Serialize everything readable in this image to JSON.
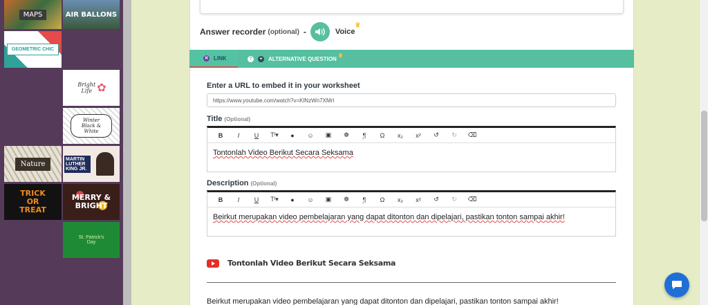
{
  "themes": [
    {
      "label": "MAPS"
    },
    {
      "label": "AIR BALLONS"
    },
    {
      "label": "GEOMETRIC CHIC"
    },
    {
      "label": "Bright Life"
    },
    {
      "label": "Winter Black & White"
    },
    {
      "label": "Nature"
    },
    {
      "label": "MARTIN LUTHER KING JR."
    },
    {
      "label": "TRICK OR TREAT"
    },
    {
      "label": "MERRY & BRIGHT"
    },
    {
      "label": "St. Patrick's Day"
    }
  ],
  "recorder": {
    "label": "Answer recorder",
    "optional": "(optional)",
    "dash": "-",
    "voice": "Voice"
  },
  "tabs": {
    "link": "LINK",
    "alternative": "ALTERNATIVE QUESTION"
  },
  "embed": {
    "label": "Enter a URL to embed it in your worksheet",
    "url_value": "https://www.youtube.com/watch?v=KlNzWn7XMrI"
  },
  "title_field": {
    "label": "Title",
    "optional": "(Optional)",
    "value": "Tontonlah Video Berikut Secara Seksama"
  },
  "description_field": {
    "label": "Description",
    "optional": "(Optional)",
    "value": "Beirkut merupakan video pembelajaran yang dapat ditonton dan dipelajari, pastikan tonton sampai akhir!"
  },
  "toolbar": [
    "B",
    "I",
    "U",
    "Tᴵ▾",
    "●",
    "☺",
    "▣",
    "❁",
    "¶",
    "Ω",
    "x₂",
    "x²",
    "↺",
    "↻",
    "⌫"
  ],
  "preview": {
    "title": "Tontonlah Video Berikut Secara Seksama",
    "description": "Beirkut merupakan video pembelajaran yang dapat ditonton dan dipelajari, pastikan tonton sampai akhir!"
  },
  "colors": {
    "accent": "#55bf9f",
    "sidebar": "#553a5a",
    "background": "#e6edc6",
    "chat": "#1f6fd6"
  }
}
